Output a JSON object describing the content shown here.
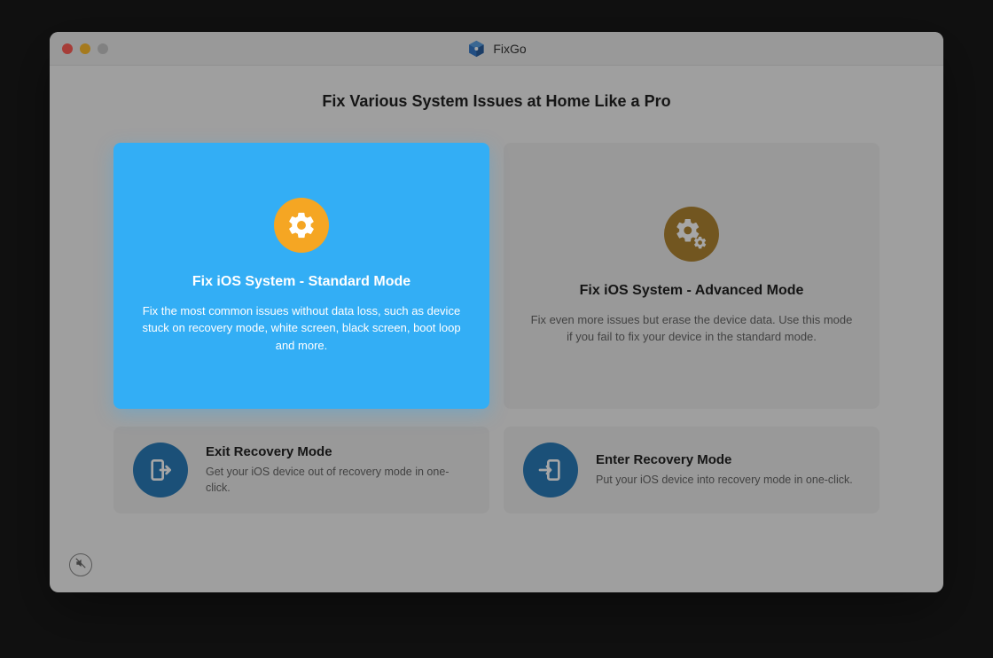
{
  "app": {
    "title": "FixGo"
  },
  "headline": "Fix Various System Issues at Home Like a Pro",
  "cards": {
    "standard": {
      "title": "Fix iOS System - Standard Mode",
      "description": "Fix the most common issues without data loss, such as device stuck on recovery mode, white screen, black screen, boot loop and more."
    },
    "advanced": {
      "title": "Fix iOS System - Advanced Mode",
      "description": "Fix even more issues but erase the device data. Use this mode if you fail to fix your device in the standard mode."
    },
    "exit": {
      "title": "Exit Recovery Mode",
      "description": "Get your iOS device out of recovery mode in one-click."
    },
    "enter": {
      "title": "Enter Recovery Mode",
      "description": "Put your iOS device into recovery mode in one-click."
    }
  },
  "icons": {
    "gear": "gear-icon",
    "gears": "gears-icon",
    "exit": "exit-door-icon",
    "enter": "enter-door-icon",
    "mute": "mute-speaker-icon",
    "logo": "cube-icon"
  }
}
